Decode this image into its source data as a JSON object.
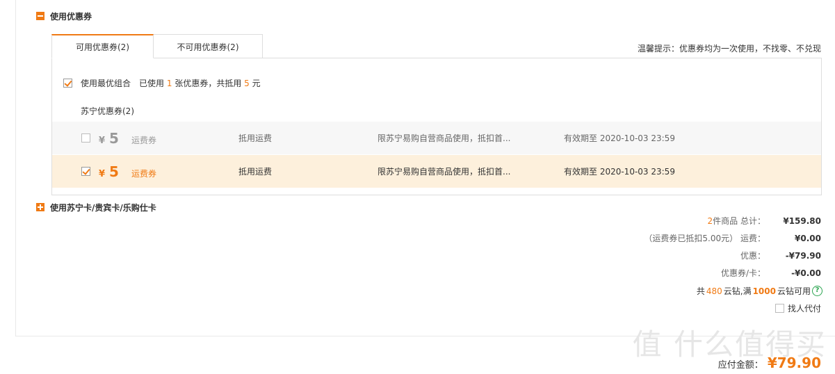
{
  "coupon_section": {
    "title": "使用优惠券"
  },
  "tabs": [
    {
      "label": "可用优惠券(2)",
      "active": true
    },
    {
      "label": "不可用优惠券(2)",
      "active": false
    }
  ],
  "hint": "温馨提示：优惠券均为一次使用，不找零、不兑现",
  "best_combo": {
    "checked": true,
    "label": "使用最优组合",
    "used_prefix": "已使用",
    "used_count": "1",
    "used_mid": "张优惠券，共抵用",
    "used_amount": "5",
    "used_suffix": "元"
  },
  "group_label": "苏宁优惠券(2)",
  "coupons": [
    {
      "checked": false,
      "currency": "¥",
      "amount": "5",
      "type": "运费券",
      "use": "抵用运费",
      "limit": "限苏宁易购自营商品使用，抵扣首...",
      "expiry": "有效期至 2020-10-03 23:59"
    },
    {
      "checked": true,
      "currency": "¥",
      "amount": "5",
      "type": "运费券",
      "use": "抵用运费",
      "limit": "限苏宁易购自营商品使用，抵扣首...",
      "expiry": "有效期至 2020-10-03 23:59"
    }
  ],
  "card_section": {
    "title": "使用苏宁卡/贵宾卡/乐购仕卡"
  },
  "summary": {
    "items_count": "2",
    "items_label": "件商品 总计：",
    "total": "¥159.80",
    "shipping_note": "（运费券已抵扣5.00元）",
    "shipping_label": "运费：",
    "shipping": "¥0.00",
    "discount_label": "优惠：",
    "discount": "-¥79.90",
    "coupon_label": "优惠券/卡：",
    "coupon": "-¥0.00"
  },
  "diamond": {
    "prefix": "共",
    "count": "480",
    "mid": "云钻,满",
    "threshold": "1000",
    "suffix": "云钻可用",
    "help_icon": "question-circle-icon"
  },
  "proxy_pay": {
    "label": "找人代付",
    "checked": false
  },
  "payable": {
    "label": "应付金额：",
    "value": "¥79.90"
  },
  "watermark": "值 什么值得买",
  "colors": {
    "accent": "#f07a14",
    "selected_bg": "#fdf0dc",
    "disabled_bg": "#f7f7f7",
    "help_green": "#2aa44f"
  }
}
